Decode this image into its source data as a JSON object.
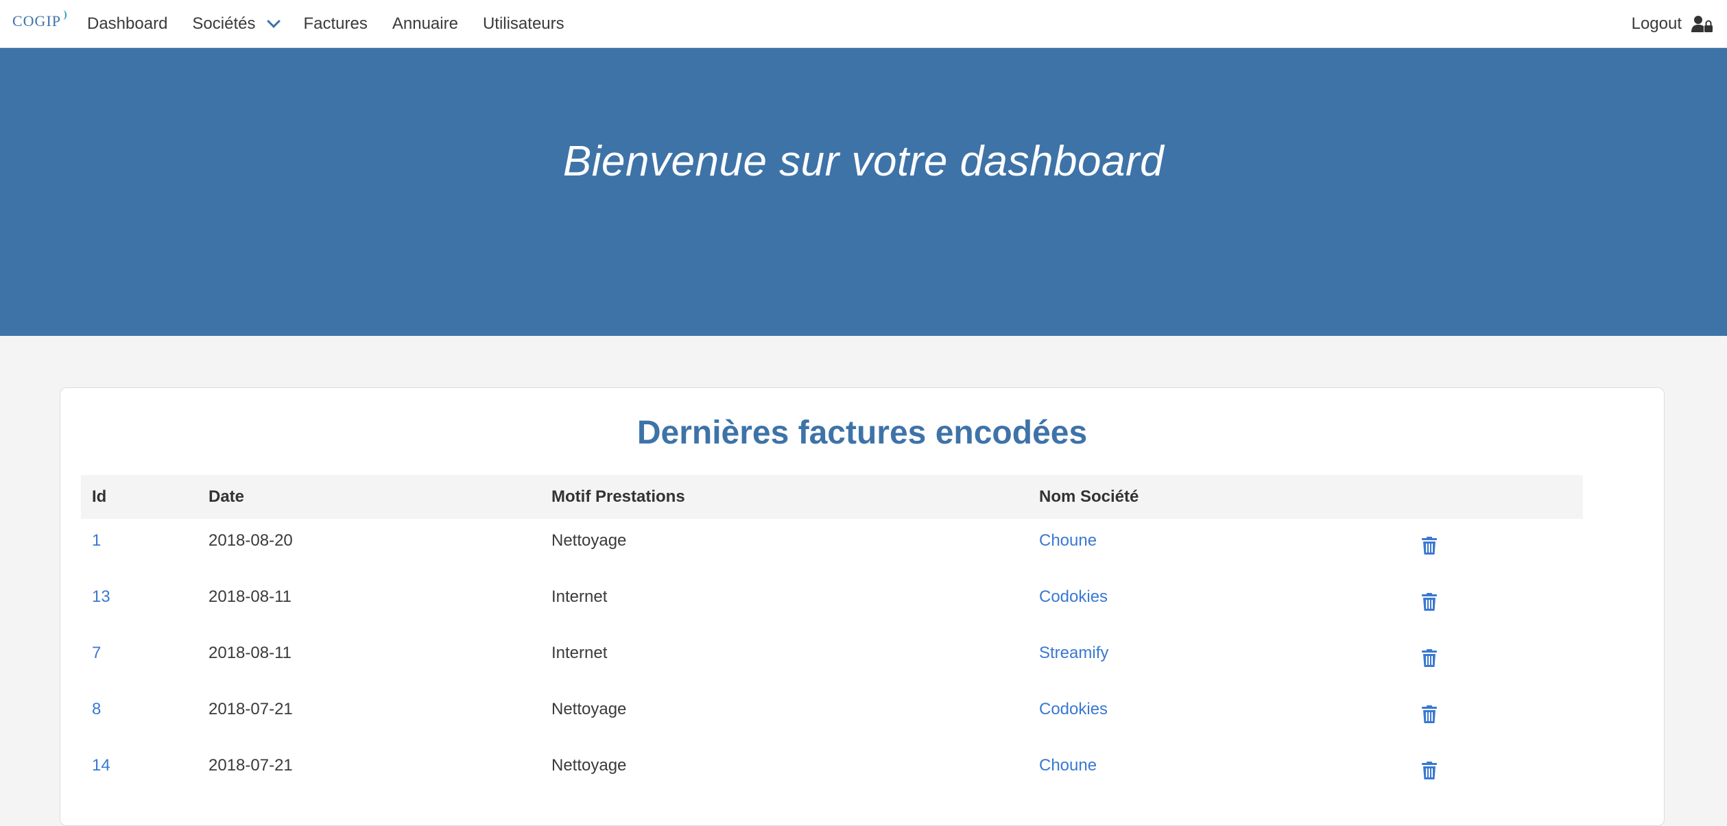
{
  "brand": {
    "logo_text": "COGIP"
  },
  "nav": {
    "items": [
      {
        "label": "Dashboard"
      },
      {
        "label": "Sociétés"
      },
      {
        "label": "Factures"
      },
      {
        "label": "Annuaire"
      },
      {
        "label": "Utilisateurs"
      }
    ],
    "logout_label": "Logout",
    "logout_icon": "user-lock-icon",
    "dropdown_icon": "chevron-down-icon"
  },
  "hero": {
    "title": "Bienvenue sur votre dashboard"
  },
  "invoices": {
    "title": "Dernières factures encodées",
    "columns": [
      "Id",
      "Date",
      "Motif Prestations",
      "Nom Société",
      ""
    ],
    "rows": [
      {
        "id": "1",
        "date": "2018-08-20",
        "motif": "Nettoyage",
        "societe": "Choune"
      },
      {
        "id": "13",
        "date": "2018-08-11",
        "motif": "Internet",
        "societe": "Codokies"
      },
      {
        "id": "7",
        "date": "2018-08-11",
        "motif": "Internet",
        "societe": "Streamify"
      },
      {
        "id": "8",
        "date": "2018-07-21",
        "motif": "Nettoyage",
        "societe": "Codokies"
      },
      {
        "id": "14",
        "date": "2018-07-21",
        "motif": "Nettoyage",
        "societe": "Choune"
      }
    ],
    "row_action_icon": "trash-icon"
  },
  "colors": {
    "primary": "#3e73a8",
    "link": "#3a78d2",
    "background": "#f4f4f4"
  }
}
